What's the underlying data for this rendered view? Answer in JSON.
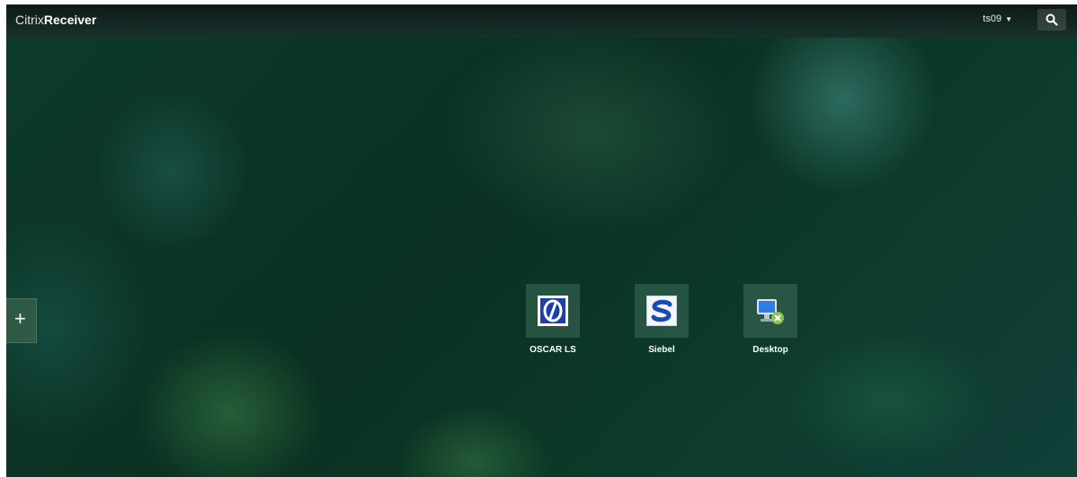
{
  "header": {
    "brand_prefix": "Citrix",
    "brand_name": "Receiver",
    "user": "ts09"
  },
  "icons": {
    "search": "search-icon",
    "add": "plus-icon",
    "user_menu": "chevron-down-icon"
  },
  "apps": [
    {
      "label": "OSCAR LS",
      "icon": "oscar-ls-icon"
    },
    {
      "label": "Siebel",
      "icon": "siebel-icon"
    },
    {
      "label": "Desktop",
      "icon": "desktop-icon"
    }
  ],
  "colors": {
    "background": "#0b3022",
    "accent": "#2a5bd7"
  }
}
